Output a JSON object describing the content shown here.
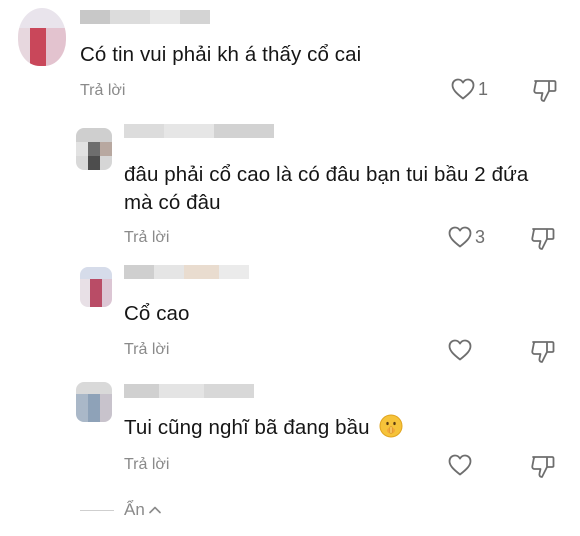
{
  "comments": [
    {
      "text": "Có tin vui phải kh á thấy cổ cai",
      "reply_label": "Trả lời",
      "like_count": "1"
    },
    {
      "text_line1": "đâu phải cổ cao là có đâu bạn tui bầu 2 đứa",
      "text_line2": "mà có đâu",
      "reply_label": "Trả lời",
      "like_count": "3"
    },
    {
      "text": "Cổ cao",
      "reply_label": "Trả lời",
      "like_count": ""
    },
    {
      "text": "Tui cũng nghĩ bã đang bầu",
      "reply_label": "Trả lời",
      "like_count": "",
      "emoji": "shushing-face-emoji"
    }
  ],
  "footer": {
    "hide_label": "Ẩn",
    "chevron_icon": "chevron-up-icon"
  },
  "icons": {
    "like": "heart-outline-icon",
    "dislike": "thumbs-down-outline-icon"
  },
  "colors": {
    "text": "#161616",
    "muted": "#8a8a8a",
    "icon": "#6e6e6e"
  }
}
